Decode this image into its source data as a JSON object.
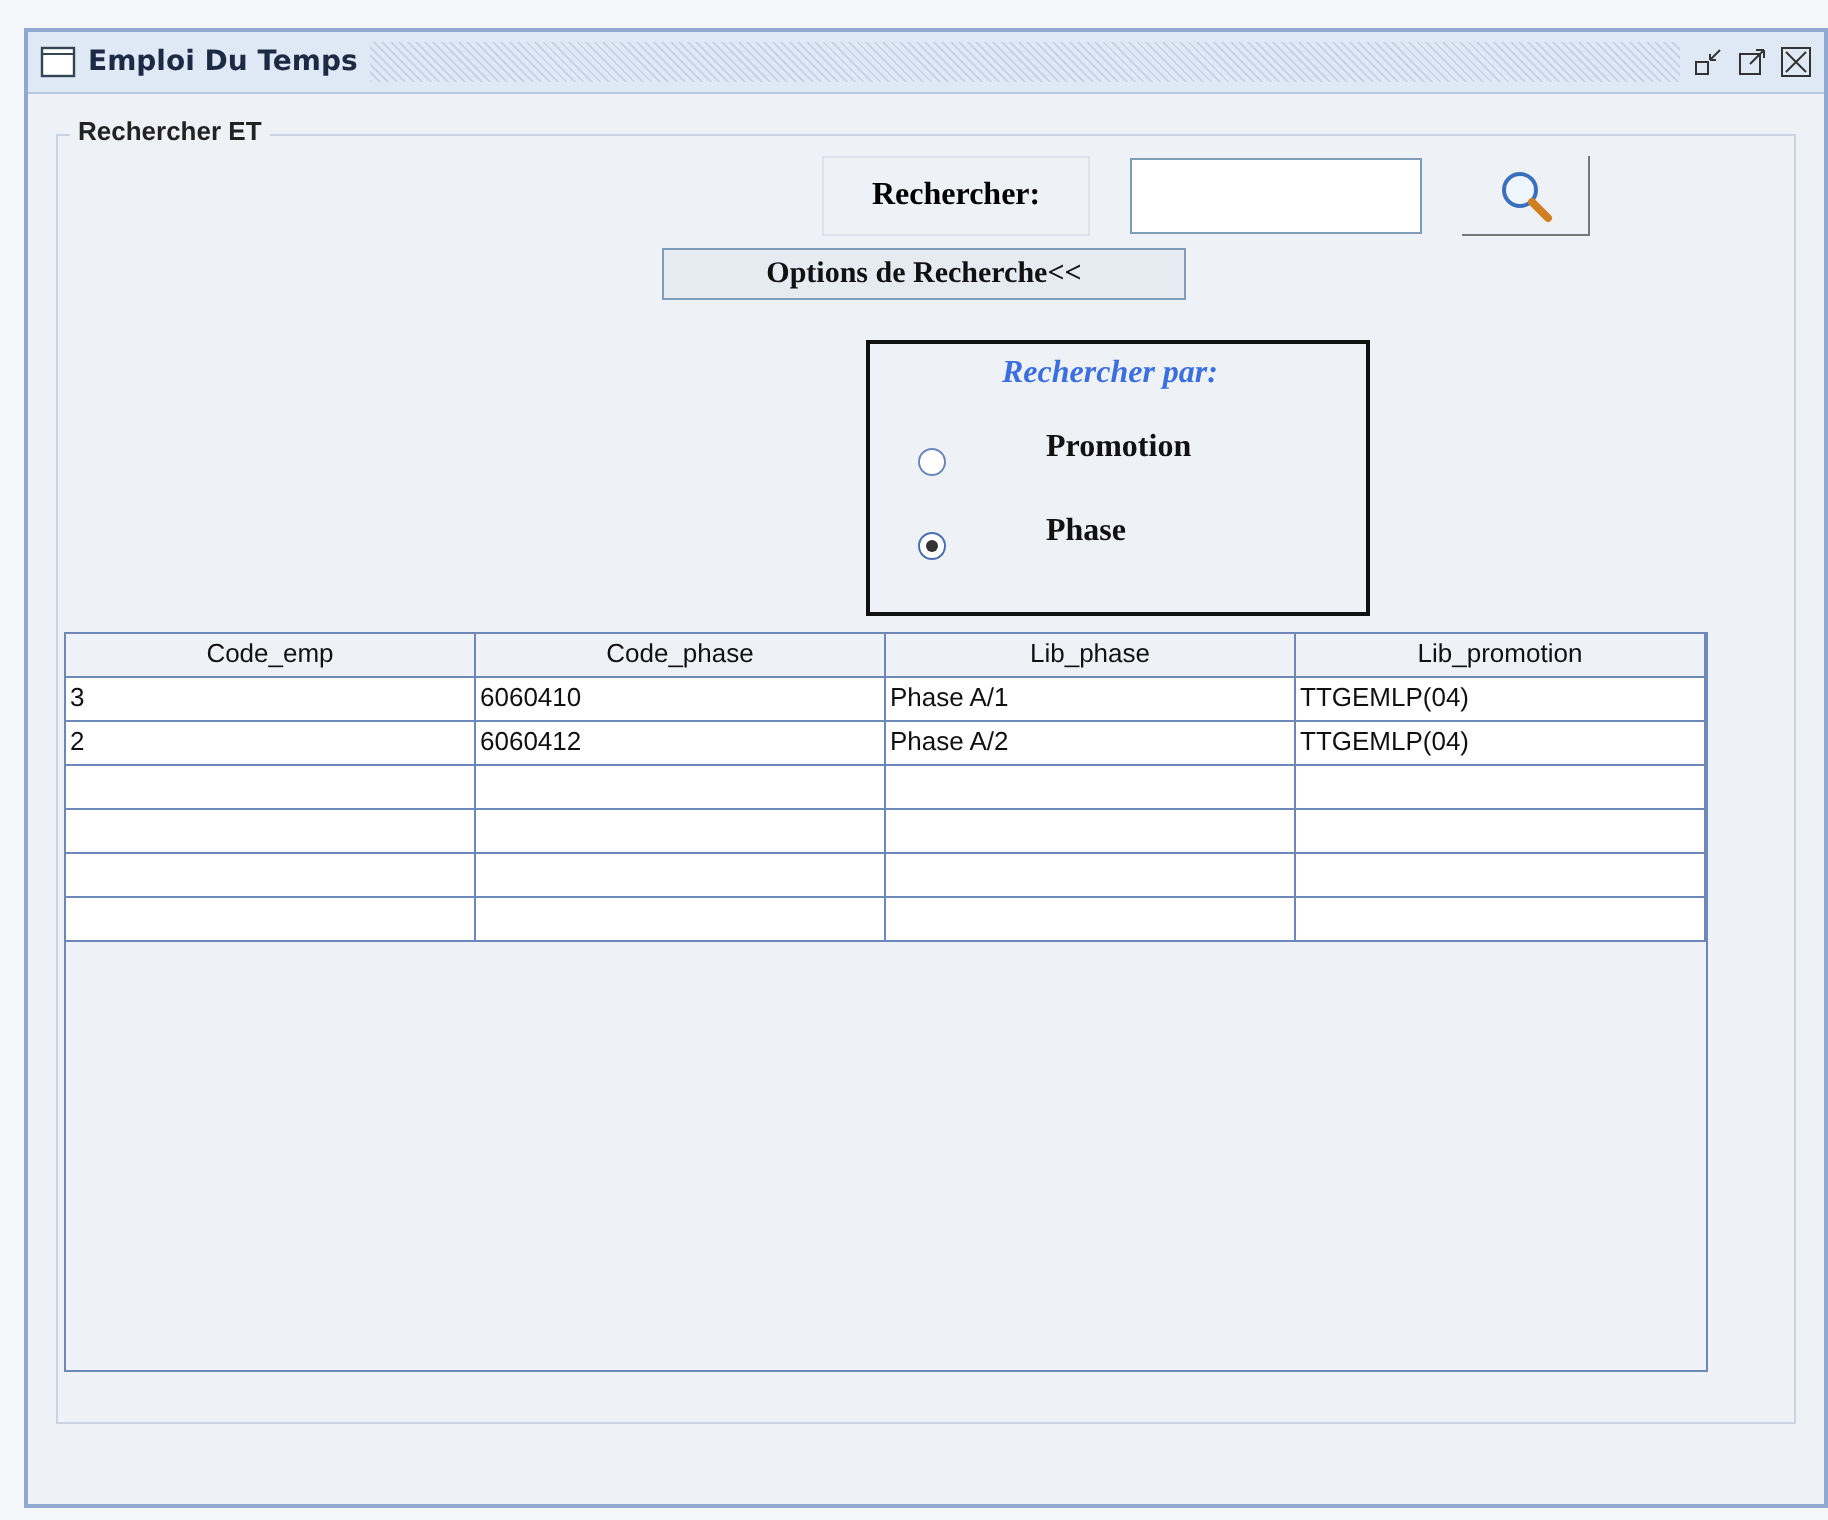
{
  "window": {
    "title": "Emploi Du Temps"
  },
  "group": {
    "title": "Rechercher ET"
  },
  "search": {
    "label": "Rechercher:",
    "options_button": "Options de Recherche<<"
  },
  "options": {
    "title": "Rechercher par:",
    "radios": [
      {
        "label": "Promotion",
        "selected": false
      },
      {
        "label": "Phase",
        "selected": true
      }
    ]
  },
  "table": {
    "columns": [
      "Code_emp",
      "Code_phase",
      "Lib_phase",
      "Lib_promotion"
    ],
    "rows": [
      [
        "3",
        "6060410",
        "Phase A/1",
        "TTGEMLP(04)"
      ],
      [
        "2",
        "6060412",
        "Phase A/2",
        "TTGEMLP(04)"
      ]
    ]
  }
}
